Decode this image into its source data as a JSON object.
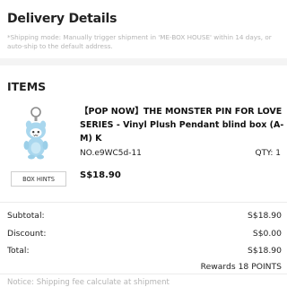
{
  "delivery": {
    "title": "Delivery Details",
    "note": "*Shipping mode: Manually trigger shipment in 'ME-BOX HOUSE' within 14 days, or auto-ship to the default address."
  },
  "items": {
    "title": "ITEMS",
    "product": {
      "name": "【POP NOW】THE MONSTER PIN FOR LOVE SERIES - Vinyl Plush Pendant blind box (A-M) K",
      "code": "NO.e9WC5d-11",
      "qty": "QTY: 1",
      "price": "S$18.90",
      "box_hints_label": "BOX HINTS"
    }
  },
  "summary": {
    "subtotal_label": "Subtotal:",
    "subtotal_value": "S$18.90",
    "discount_label": "Discount:",
    "discount_value": "S$0.00",
    "total_label": "Total:",
    "total_value": "S$18.90",
    "rewards": "Rewards 18 POINTS"
  },
  "notice": "Notice: Shipping fee calculate at shipment",
  "colors": {
    "background": "#ffffff",
    "section_gap": "#f4f4f4",
    "muted_text": "#b4b4b4",
    "plush_body": "#a9d7ee"
  }
}
